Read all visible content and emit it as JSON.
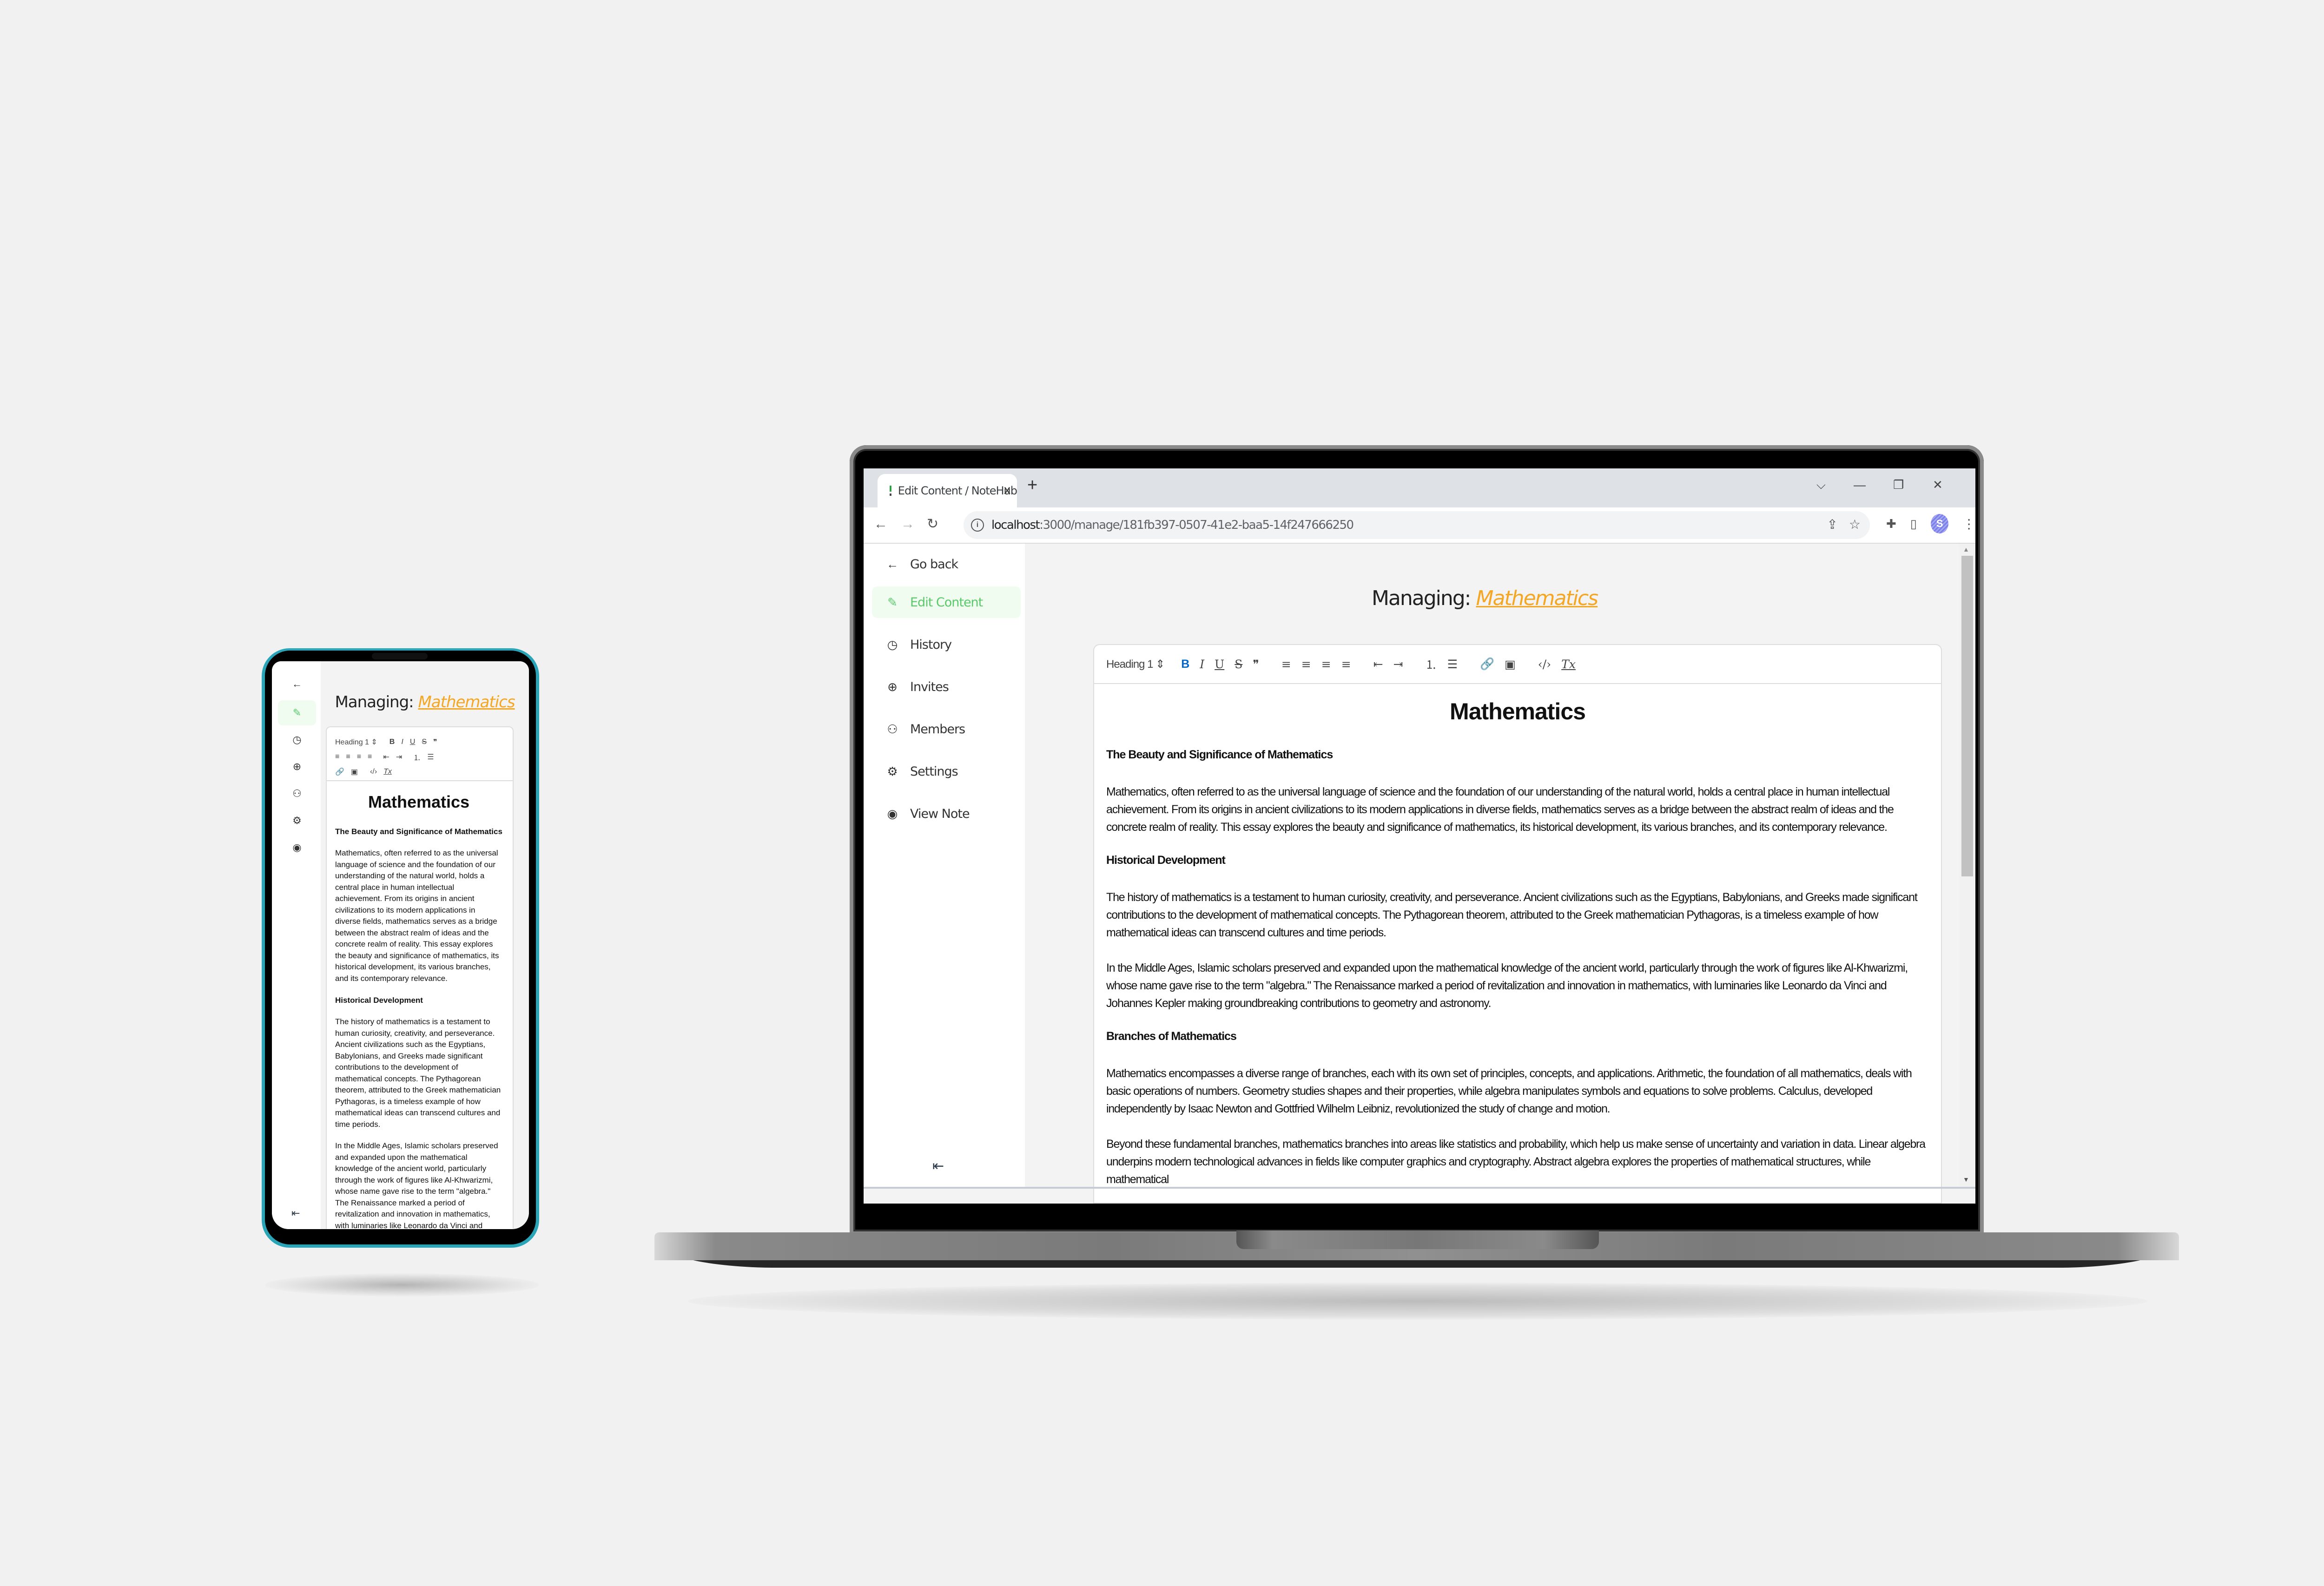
{
  "browser": {
    "tab_title": "Edit Content / NoteHub",
    "tab_close": "x",
    "new_tab": "+",
    "window_controls": {
      "tab_search": "⌵",
      "minimize": "—",
      "restore": "❐",
      "close": "✕"
    },
    "nav": {
      "back": "←",
      "forward": "→",
      "reload": "↻"
    },
    "url_host": "localhost",
    "url_path": ":3000/manage/181fb397-0507-41e2-baa5-14f247666250",
    "profile_initial": "S"
  },
  "sidebar": {
    "items": [
      {
        "label": "Go back",
        "icon": "←"
      },
      {
        "label": "Edit Content",
        "icon": "✎",
        "active": true
      },
      {
        "label": "History",
        "icon": "◷"
      },
      {
        "label": "Invites",
        "icon": "⊕"
      },
      {
        "label": "Members",
        "icon": "⚇"
      },
      {
        "label": "Settings",
        "icon": "⚙"
      },
      {
        "label": "View Note",
        "icon": "◉"
      }
    ],
    "collapse_icon": "⇤"
  },
  "page": {
    "managing_label": "Managing: ",
    "note_name": "Mathematics",
    "accent_color": "#f5a623",
    "active_color": "#5bc96b"
  },
  "editor": {
    "toolbar": {
      "heading_select": "Heading 1 ⇕",
      "bold": "B",
      "italic": "I",
      "underline": "U",
      "strike": "S",
      "blockquote": "❞",
      "align_left": "≡",
      "align_center": "≡",
      "align_right": "≡",
      "align_justify": "≡",
      "outdent": "⇤",
      "indent": "⇥",
      "ordered_list": "⒈",
      "bullet_list": "☰",
      "link": "🔗",
      "image": "▣",
      "code": "‹/›",
      "clear_format": "Tx"
    },
    "content": {
      "title": "Mathematics",
      "sections": [
        {
          "heading": "The Beauty and Significance of Mathematics",
          "paragraphs": [
            "Mathematics, often referred to as the universal language of science and the foundation of our understanding of the natural world, holds a central place in human intellectual achievement. From its origins in ancient civilizations to its modern applications in diverse fields, mathematics serves as a bridge between the abstract realm of ideas and the concrete realm of reality. This essay explores the beauty and significance of mathematics, its historical development, its various branches, and its contemporary relevance."
          ]
        },
        {
          "heading": "Historical Development",
          "paragraphs": [
            "The history of mathematics is a testament to human curiosity, creativity, and perseverance. Ancient civilizations such as the Egyptians, Babylonians, and Greeks made significant contributions to the development of mathematical concepts. The Pythagorean theorem, attributed to the Greek mathematician Pythagoras, is a timeless example of how mathematical ideas can transcend cultures and time periods.",
            "In the Middle Ages, Islamic scholars preserved and expanded upon the mathematical knowledge of the ancient world, particularly through the work of figures like Al-Khwarizmi, whose name gave rise to the term \"algebra.\" The Renaissance marked a period of revitalization and innovation in mathematics, with luminaries like Leonardo da Vinci and Johannes Kepler making groundbreaking contributions to geometry and astronomy."
          ]
        },
        {
          "heading": "Branches of Mathematics",
          "paragraphs": [
            "Mathematics encompasses a diverse range of branches, each with its own set of principles, concepts, and applications. Arithmetic, the foundation of all mathematics, deals with basic operations of numbers. Geometry studies shapes and their properties, while algebra manipulates symbols and equations to solve problems. Calculus, developed independently by Isaac Newton and Gottfried Wilhelm Leibniz, revolutionized the study of change and motion.",
            "Beyond these fundamental branches, mathematics branches into areas like statistics and probability, which help us make sense of uncertainty and variation in data. Linear algebra underpins modern technological advances in fields like computer graphics and cryptography. Abstract algebra explores the properties of mathematical structures, while mathematical"
          ]
        }
      ]
    }
  },
  "scrollbar": {
    "up": "▲",
    "down": "▼",
    "position_fraction": 0.0
  }
}
